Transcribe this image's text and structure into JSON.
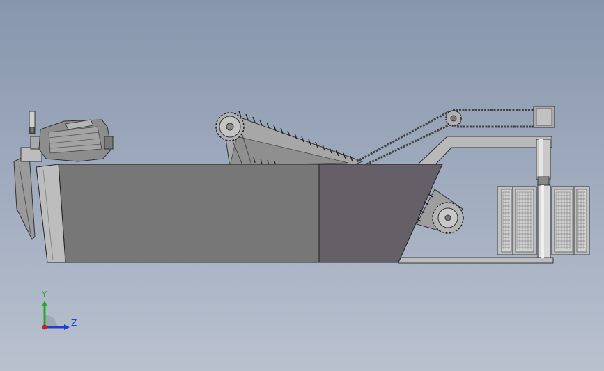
{
  "viewport": {
    "background_top": "#8796ad",
    "background_bottom": "#b9c1cf"
  },
  "model": {
    "tank_front_color": "#777777",
    "tank_rear_color": "#655f67",
    "frame_color": "#b8b8b8",
    "chain_color": "#555555",
    "motor_color": "#8a8a8a",
    "pulley_icon": "sprocket-icon",
    "filter_icon": "filter-block-icon"
  },
  "triad": {
    "y_label": "Y",
    "z_label": "Z",
    "y_color": "#1faa1f",
    "z_color": "#1f3fd0",
    "x_color": "#d01f1f"
  }
}
